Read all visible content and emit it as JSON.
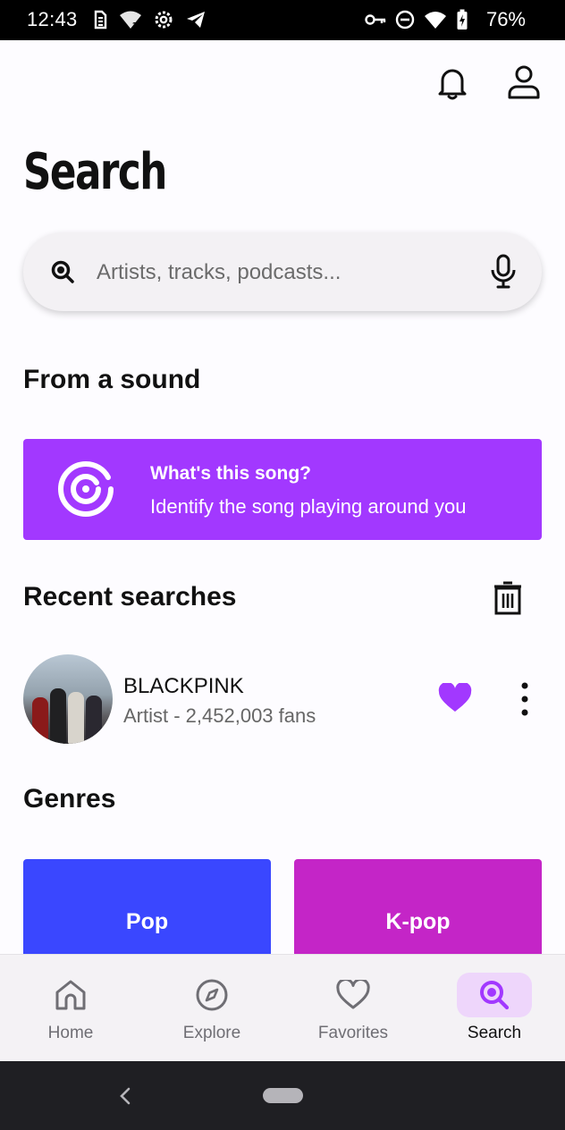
{
  "status_bar": {
    "time": "12:43",
    "battery": "76%"
  },
  "header": {
    "title": "Search",
    "icons": [
      "bell-icon",
      "profile-icon"
    ]
  },
  "search": {
    "placeholder": "Artists, tracks, podcasts...",
    "value": ""
  },
  "from_sound": {
    "heading": "From a sound",
    "card_title": "What's this song?",
    "card_subtitle": "Identify the song playing around you",
    "accent": "#a238ff"
  },
  "recent": {
    "heading": "Recent searches",
    "items": [
      {
        "name": "BLACKPINK",
        "meta": "Artist - 2,452,003 fans",
        "liked": true
      }
    ]
  },
  "genres": {
    "heading": "Genres",
    "items": [
      {
        "label": "Pop",
        "color": "#3a47ff"
      },
      {
        "label": "K-pop",
        "color": "#c425c7"
      }
    ]
  },
  "nav": {
    "items": [
      {
        "label": "Home",
        "icon": "home-icon"
      },
      {
        "label": "Explore",
        "icon": "compass-icon"
      },
      {
        "label": "Favorites",
        "icon": "heart-icon"
      },
      {
        "label": "Search",
        "icon": "search-icon",
        "active": true
      }
    ]
  }
}
